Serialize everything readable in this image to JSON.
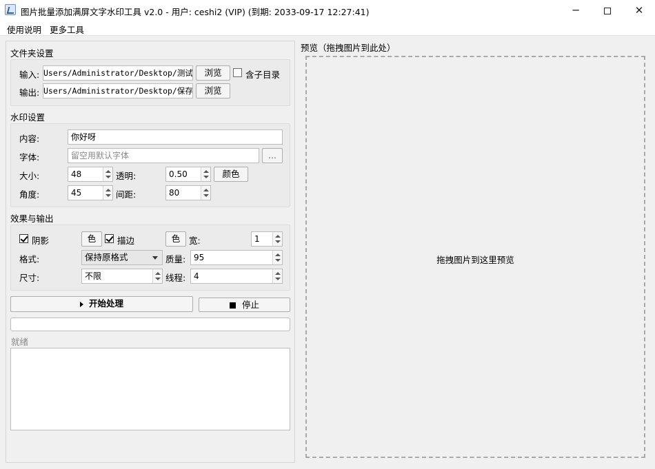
{
  "window": {
    "title": "图片批量添加满屏文字水印工具 v2.0 - 用户: ceshi2 (VIP) (到期: 2033-09-17 12:27:41)",
    "minimize": "─",
    "close": "✕"
  },
  "menu": [
    "使用说明",
    "更多工具"
  ],
  "folder": {
    "title": "文件夹设置",
    "input_label": "输入:",
    "input_value": "Users/Administrator/Desktop/测试图片",
    "output_label": "输出:",
    "output_value": "Users/Administrator/Desktop/保存目录",
    "browse": "浏览",
    "subdir_label": "含子目录",
    "subdir_checked": false
  },
  "watermark": {
    "title": "水印设置",
    "content_label": "内容:",
    "content_value": "你好呀",
    "font_label": "字体:",
    "font_placeholder": "留空用默认字体",
    "font_button": "...",
    "size_label": "大小:",
    "size_value": "48",
    "opacity_label": "透明:",
    "opacity_value": "0.50",
    "color_button": "颜色",
    "angle_label": "角度:",
    "angle_value": "45",
    "spacing_label": "间距:",
    "spacing_value": "80"
  },
  "effects": {
    "title": "效果与输出",
    "shadow_label": "阴影",
    "shadow_checked": true,
    "color_button": "色",
    "stroke_label": "描边",
    "stroke_checked": true,
    "width_label": "宽:",
    "width_value": "1",
    "format_label": "格式:",
    "format_value": "保持原格式",
    "quality_label": "质量:",
    "quality_value": "95",
    "size_label": "尺寸:",
    "size_value": "不限",
    "threads_label": "线程:",
    "threads_value": "4"
  },
  "actions": {
    "start": "开始处理",
    "stop": "停止"
  },
  "status": "就绪",
  "preview": {
    "title": "预览（拖拽图片到此处）",
    "drop_text": "拖拽图片到这里预览"
  }
}
